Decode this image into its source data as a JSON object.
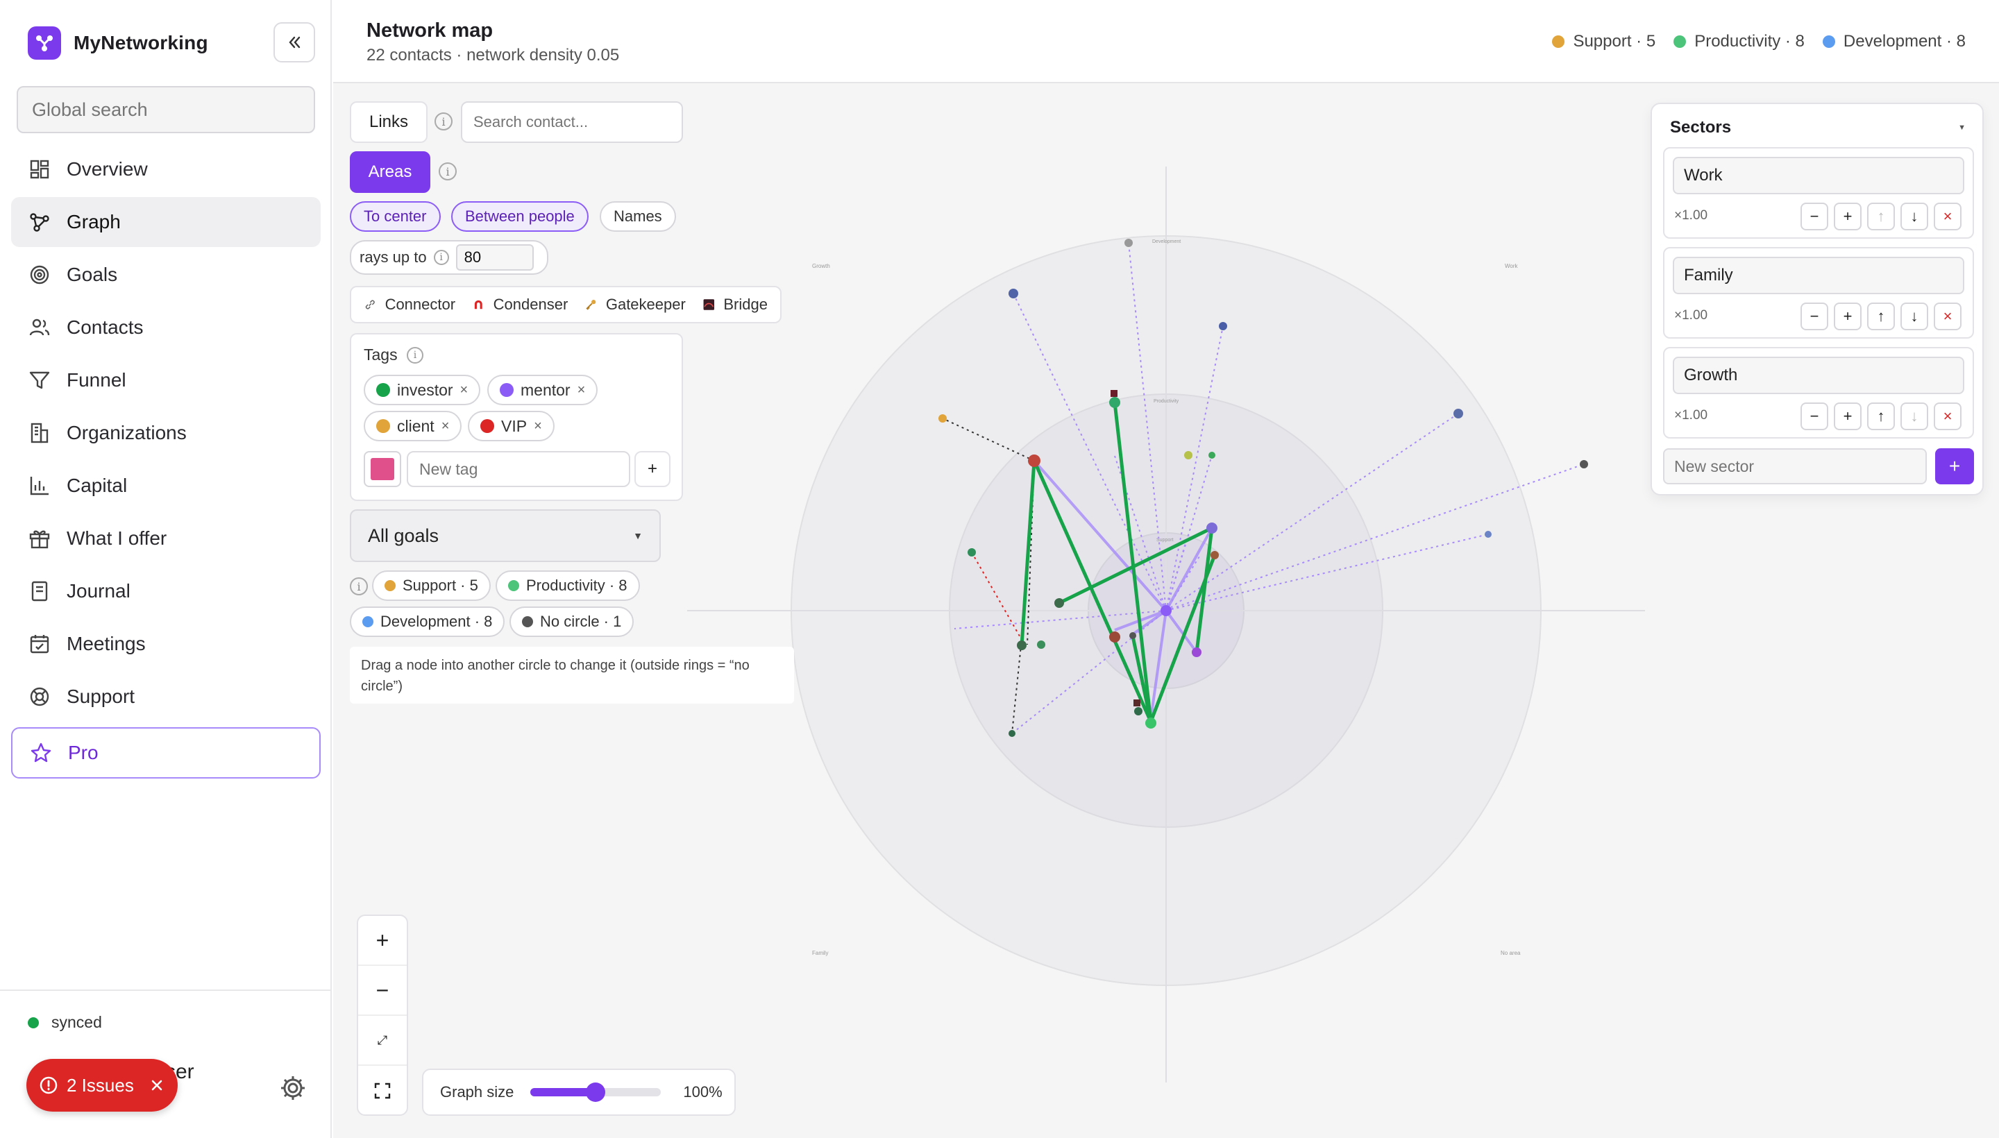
{
  "app": {
    "name": "MyNetworking",
    "search_placeholder": "Global search"
  },
  "nav": {
    "items": [
      {
        "label": "Overview",
        "icon": "dashboard-icon"
      },
      {
        "label": "Graph",
        "icon": "graph-icon",
        "active": true
      },
      {
        "label": "Goals",
        "icon": "target-icon"
      },
      {
        "label": "Contacts",
        "icon": "users-icon"
      },
      {
        "label": "Funnel",
        "icon": "funnel-icon"
      },
      {
        "label": "Organizations",
        "icon": "building-icon"
      },
      {
        "label": "Capital",
        "icon": "bar-chart-icon"
      },
      {
        "label": "What I offer",
        "icon": "gift-icon"
      },
      {
        "label": "Journal",
        "icon": "journal-icon"
      },
      {
        "label": "Meetings",
        "icon": "calendar-icon"
      },
      {
        "label": "Support",
        "icon": "lifebuoy-icon"
      }
    ],
    "pro_label": "Pro"
  },
  "footer": {
    "sync_status": "synced",
    "user_name_fragment": "ser",
    "issues_label": "2 Issues"
  },
  "header": {
    "title": "Network map",
    "subtitle": "22 contacts · network density 0.05",
    "legend": [
      {
        "label": "Support · 5",
        "color": "#e0a43a"
      },
      {
        "label": "Productivity · 8",
        "color": "#4cc47a"
      },
      {
        "label": "Development · 8",
        "color": "#5b9bf0"
      }
    ]
  },
  "controls": {
    "links_label": "Links",
    "search_placeholder": "Search contact...",
    "areas_label": "Areas",
    "toggles": [
      "To center",
      "Between people",
      "Names"
    ],
    "rays_label": "rays up to",
    "rays_value": "80",
    "roles": [
      {
        "label": "Connector",
        "icon": "link-icon"
      },
      {
        "label": "Condenser",
        "icon": "magnet-icon"
      },
      {
        "label": "Gatekeeper",
        "icon": "key-icon"
      },
      {
        "label": "Bridge",
        "icon": "bridge-icon"
      }
    ],
    "tags_title": "Tags",
    "tags": [
      {
        "label": "investor",
        "color": "#16a34a"
      },
      {
        "label": "mentor",
        "color": "#8b5cf6"
      },
      {
        "label": "client",
        "color": "#e0a43a"
      },
      {
        "label": "VIP",
        "color": "#dc2626"
      }
    ],
    "new_tag_placeholder": "New tag",
    "new_tag_color": "#e0508a",
    "goals_select": "All goals",
    "circle_chips": [
      {
        "label": "Support · 5",
        "color": "#e0a43a"
      },
      {
        "label": "Productivity · 8",
        "color": "#4cc47a"
      },
      {
        "label": "Development · 8",
        "color": "#5b9bf0"
      },
      {
        "label": "No circle · 1",
        "color": "#555555"
      }
    ],
    "hint": "Drag a node into another circle to change it (outside rings = “no circle”)"
  },
  "sectors": {
    "title": "Sectors",
    "items": [
      {
        "name": "Work",
        "multiplier": "×1.00"
      },
      {
        "name": "Family",
        "multiplier": "×1.00"
      },
      {
        "name": "Growth",
        "multiplier": "×1.00"
      }
    ],
    "new_placeholder": "New sector"
  },
  "map_labels": {
    "growth": "Growth",
    "development": "Development",
    "work": "Work",
    "productivity": "Productivity",
    "support": "Support",
    "family": "Family",
    "no_area": "No area"
  },
  "graph_size": {
    "label": "Graph size",
    "value_text": "100%",
    "value": 100
  }
}
